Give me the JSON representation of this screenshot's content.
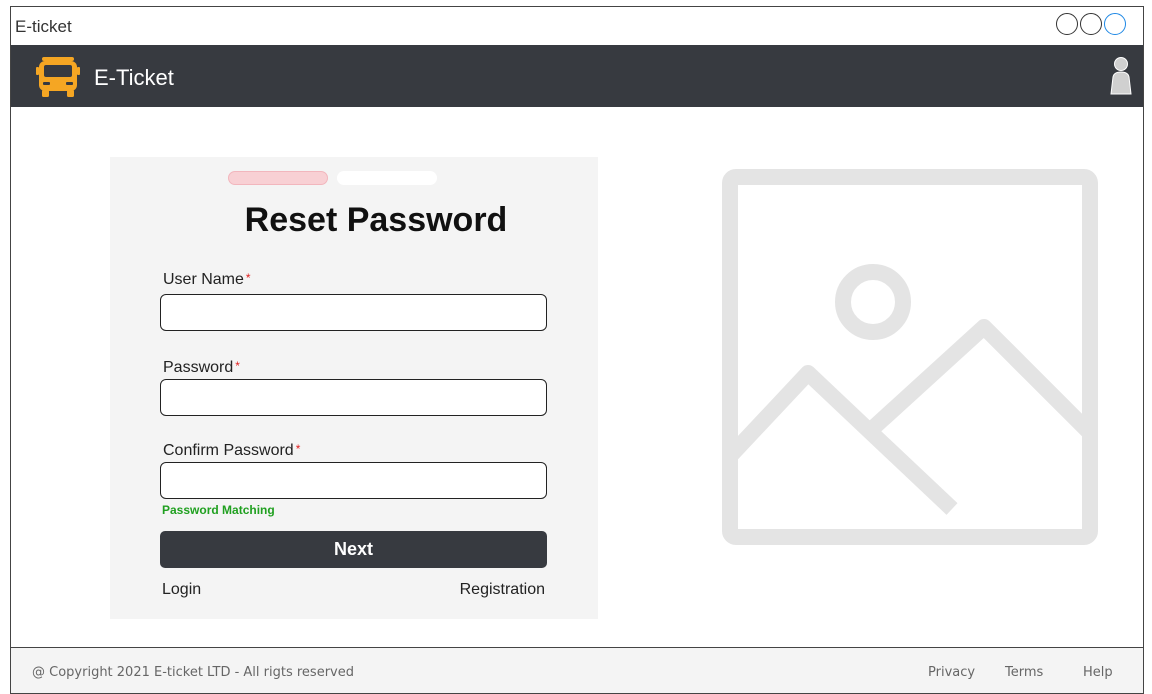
{
  "window": {
    "title": "E-ticket"
  },
  "header": {
    "brand": "E-Ticket",
    "logo_icon": "bus-icon",
    "user_icon": "user-icon"
  },
  "form": {
    "steps": [
      {
        "state": "active",
        "color": "#f8d0d4"
      },
      {
        "state": "inactive",
        "color": "#ffffff"
      }
    ],
    "title": "Reset Password",
    "fields": [
      {
        "label": "User Name",
        "required_mark": "*",
        "value": ""
      },
      {
        "label": "Password",
        "required_mark": "*",
        "value": ""
      },
      {
        "label": "Confirm Password",
        "required_mark": "*",
        "value": ""
      }
    ],
    "match_message": "Password Matching",
    "next_label": "Next",
    "login_label": "Login",
    "registration_label": "Registration"
  },
  "image_placeholder": {
    "icon": "image-placeholder-icon"
  },
  "footer": {
    "copyright": "@ Copyright 2021 E-ticket LTD - All rigts reserved",
    "links": [
      "Privacy",
      "Terms",
      "Help"
    ]
  },
  "colors": {
    "appbar": "#373a40",
    "accent_orange": "#f5a623",
    "success_green": "#20a020",
    "required_red": "#e02020"
  }
}
